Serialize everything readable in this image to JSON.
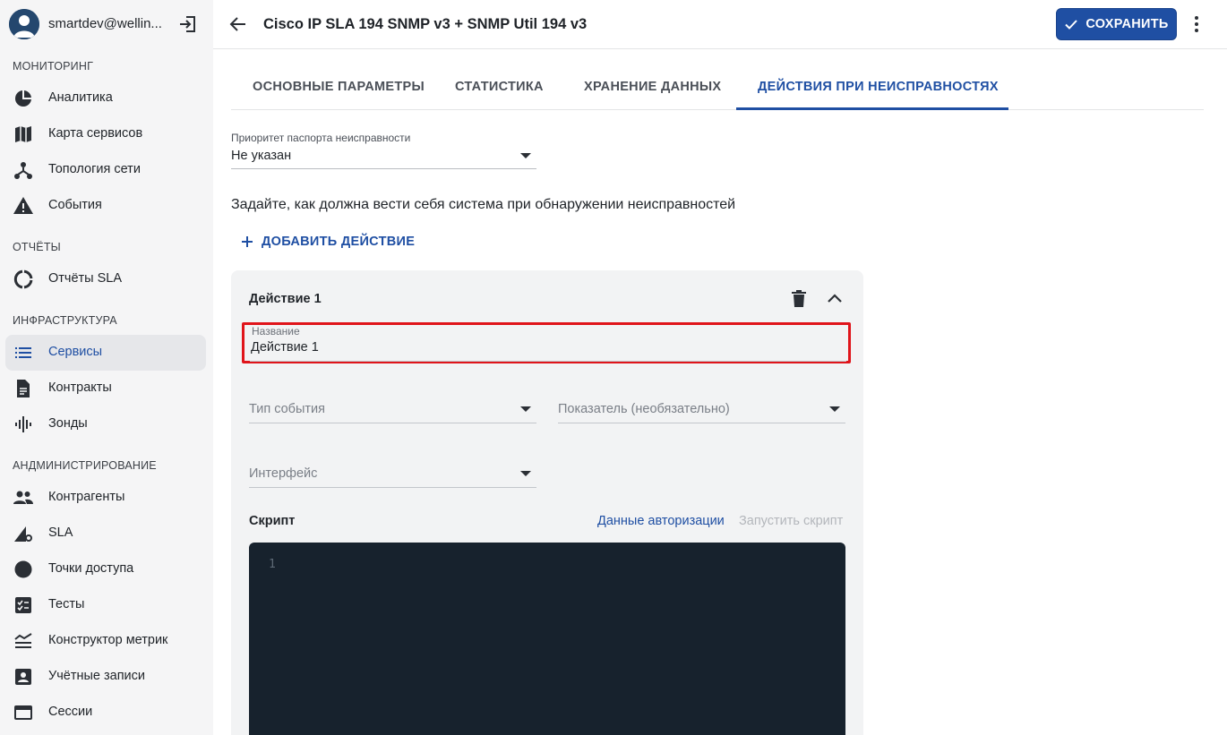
{
  "user": {
    "name": "smartdev@wellin..."
  },
  "sidebar": {
    "sections": [
      {
        "label": "МОНИТОРИНГ",
        "items": [
          {
            "label": "Аналитика",
            "icon": "pie-chart-icon"
          },
          {
            "label": "Карта сервисов",
            "icon": "map-icon"
          },
          {
            "label": "Топология сети",
            "icon": "topology-icon"
          },
          {
            "label": "События",
            "icon": "warning-icon"
          }
        ]
      },
      {
        "label": "ОТЧЁТЫ",
        "items": [
          {
            "label": "Отчёты SLA",
            "icon": "donut-icon"
          }
        ]
      },
      {
        "label": "ИНФРАСТРУКТУРА",
        "items": [
          {
            "label": "Сервисы",
            "icon": "list-icon",
            "active": true
          },
          {
            "label": "Контракты",
            "icon": "document-icon"
          },
          {
            "label": "Зонды",
            "icon": "probe-icon"
          }
        ]
      },
      {
        "label": "АНДМИНИСТРИРОВАНИЕ",
        "items": [
          {
            "label": "Контрагенты",
            "icon": "people-icon"
          },
          {
            "label": "SLA",
            "icon": "sla-icon"
          },
          {
            "label": "Точки доступа",
            "icon": "circle-icon"
          },
          {
            "label": "Тесты",
            "icon": "checklist-icon"
          },
          {
            "label": "Конструктор метрик",
            "icon": "metrics-icon"
          },
          {
            "label": "Учётные записи",
            "icon": "account-icon"
          },
          {
            "label": "Сессии",
            "icon": "window-icon"
          }
        ]
      }
    ]
  },
  "header": {
    "title": "Cisco IP SLA 194 SNMP v3 + SNMP Util 194 v3",
    "save_label": "СОХРАНИТЬ"
  },
  "tabs": [
    {
      "label": "ОСНОВНЫЕ ПАРАМЕТРЫ"
    },
    {
      "label": "СТАТИСТИКА"
    },
    {
      "label": "ХРАНЕНИЕ ДАННЫХ"
    },
    {
      "label": "ДЕЙСТВИЯ ПРИ НЕИСПРАВНОСТЯХ",
      "active": true
    }
  ],
  "priority": {
    "label": "Приоритет паспорта неисправности",
    "value": "Не указан"
  },
  "instructions": "Задайте, как должна вести себя система при обнаружении неисправностей",
  "add_action_label": "ДОБАВИТЬ ДЕЙСТВИЕ",
  "action": {
    "title": "Действие 1",
    "name_label": "Название",
    "name_value": "Действие 1",
    "event_type_placeholder": "Тип события",
    "metric_placeholder": "Показатель (необязательно)",
    "interface_placeholder": "Интерфейс",
    "script_label": "Скрипт",
    "auth_link": "Данные авторизации",
    "run_link": "Запустить скрипт",
    "line_number": "1"
  },
  "colors": {
    "accent": "#1f4fa3",
    "highlight": "#e0141a",
    "editor_bg": "#17222d"
  }
}
